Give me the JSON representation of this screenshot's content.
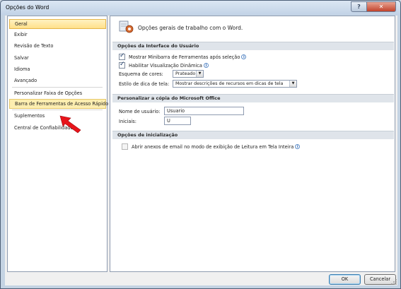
{
  "window": {
    "title": "Opções do Word",
    "help_glyph": "?",
    "close_glyph": "✕"
  },
  "nav": {
    "items": [
      {
        "label": "Geral",
        "state": "selected"
      },
      {
        "label": "Exibir"
      },
      {
        "label": "Revisão de Texto"
      },
      {
        "label": "Salvar"
      },
      {
        "label": "Idioma"
      },
      {
        "label": "Avançado"
      },
      {
        "label": "Personalizar Faixa de Opções"
      },
      {
        "label": "Barra de Ferramentas de Acesso Rápido",
        "state": "hover"
      },
      {
        "label": "Suplementos"
      },
      {
        "label": "Central de Confiabilidade"
      }
    ]
  },
  "header": {
    "text": "Opções gerais de trabalho com o Word."
  },
  "ui_section": {
    "title": "Opções da Interface do Usuário",
    "minibar": {
      "label": "Mostrar Minibarra de Ferramentas após seleção",
      "checked": true
    },
    "live_preview": {
      "label": "Habilitar Visualização Dinâmica",
      "checked": true
    },
    "color_scheme": {
      "label": "Esquema de cores:",
      "value": "Prateado"
    },
    "screentip": {
      "label": "Estilo de dica de tela:",
      "value": "Mostrar descrições de recursos em dicas de tela"
    }
  },
  "personalize_section": {
    "title": "Personalizar a cópia do Microsoft Office",
    "username": {
      "label": "Nome de usuário:",
      "value": "Usuario"
    },
    "initials": {
      "label": "Iniciais:",
      "value": "U"
    }
  },
  "startup_section": {
    "title": "Opções de inicialização",
    "reading_layout": {
      "label": "Abrir anexos de email no modo de exibição de Leitura em Tela Inteira",
      "checked": false
    }
  },
  "buttons": {
    "ok": "OK",
    "cancel": "Cancelar"
  },
  "colors": {
    "accent": "#ffe08a",
    "arrow": "#e8141a"
  }
}
